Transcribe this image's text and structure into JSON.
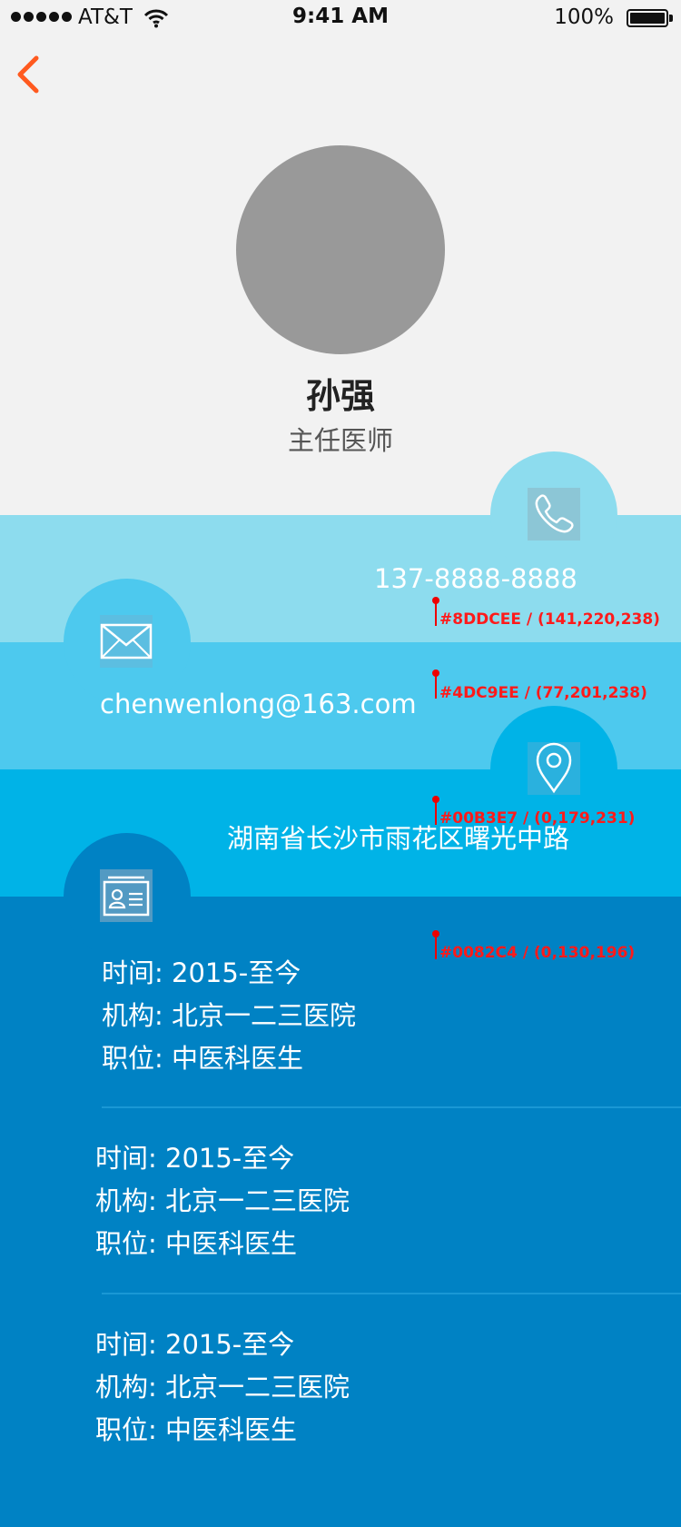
{
  "status_bar": {
    "carrier": "AT&T",
    "time": "9:41 AM",
    "battery": "100%"
  },
  "profile": {
    "name": "孙强",
    "title": "主任医师"
  },
  "contact": {
    "phone": "137-8888-8888",
    "email": "chenwenlong@163.com",
    "address": "湖南省长沙市雨花区曙光中路"
  },
  "color_swatches": [
    "#8DDCEE / (141,220,238)",
    "#4DC9EE / (77,201,238)",
    "#00B3E7 / (0,179,231)",
    "#0082C4 / (0,130,196)"
  ],
  "experience": [
    {
      "time_label": "时间:",
      "time": "2015-至今",
      "org_label": "机构:",
      "org": "北京一二三医院",
      "pos_label": "职位:",
      "pos": "中医科医生"
    },
    {
      "time_label": "时间:",
      "time": "2015-至今",
      "org_label": "机构:",
      "org": "北京一二三医院",
      "pos_label": "职位:",
      "pos": "中医科医生"
    },
    {
      "time_label": "时间:",
      "time": "2015-至今",
      "org_label": "机构:",
      "org": "北京一二三医院",
      "pos_label": "职位:",
      "pos": "中医科医生"
    }
  ],
  "icons": [
    "back-chevron-icon",
    "phone-icon",
    "mail-icon",
    "location-pin-icon",
    "id-card-icon",
    "wifi-icon",
    "battery-icon"
  ],
  "colors": {
    "band1": "#8DDCEE",
    "band2": "#4DC9EE",
    "band3": "#00B3E7",
    "band4": "#0082C4",
    "accent": "#FF5A1F"
  }
}
